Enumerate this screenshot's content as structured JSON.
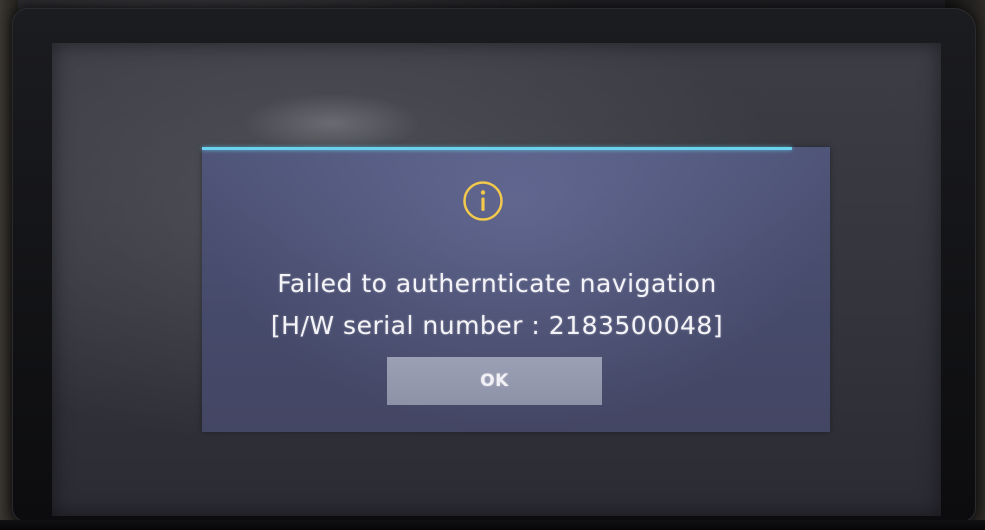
{
  "dialog": {
    "icon": "info-icon",
    "message_line1": "Failed to authernticate navigation",
    "message_line2": "[H/W serial number : 2183500048]",
    "ok_label": "OK"
  },
  "colors": {
    "dialog_background": "#4a4e70",
    "dialog_accent_line": "#6ad2ee",
    "icon_ring": "#f2c94c",
    "ok_button": "#969ab0",
    "text": "#f4f4f8"
  }
}
